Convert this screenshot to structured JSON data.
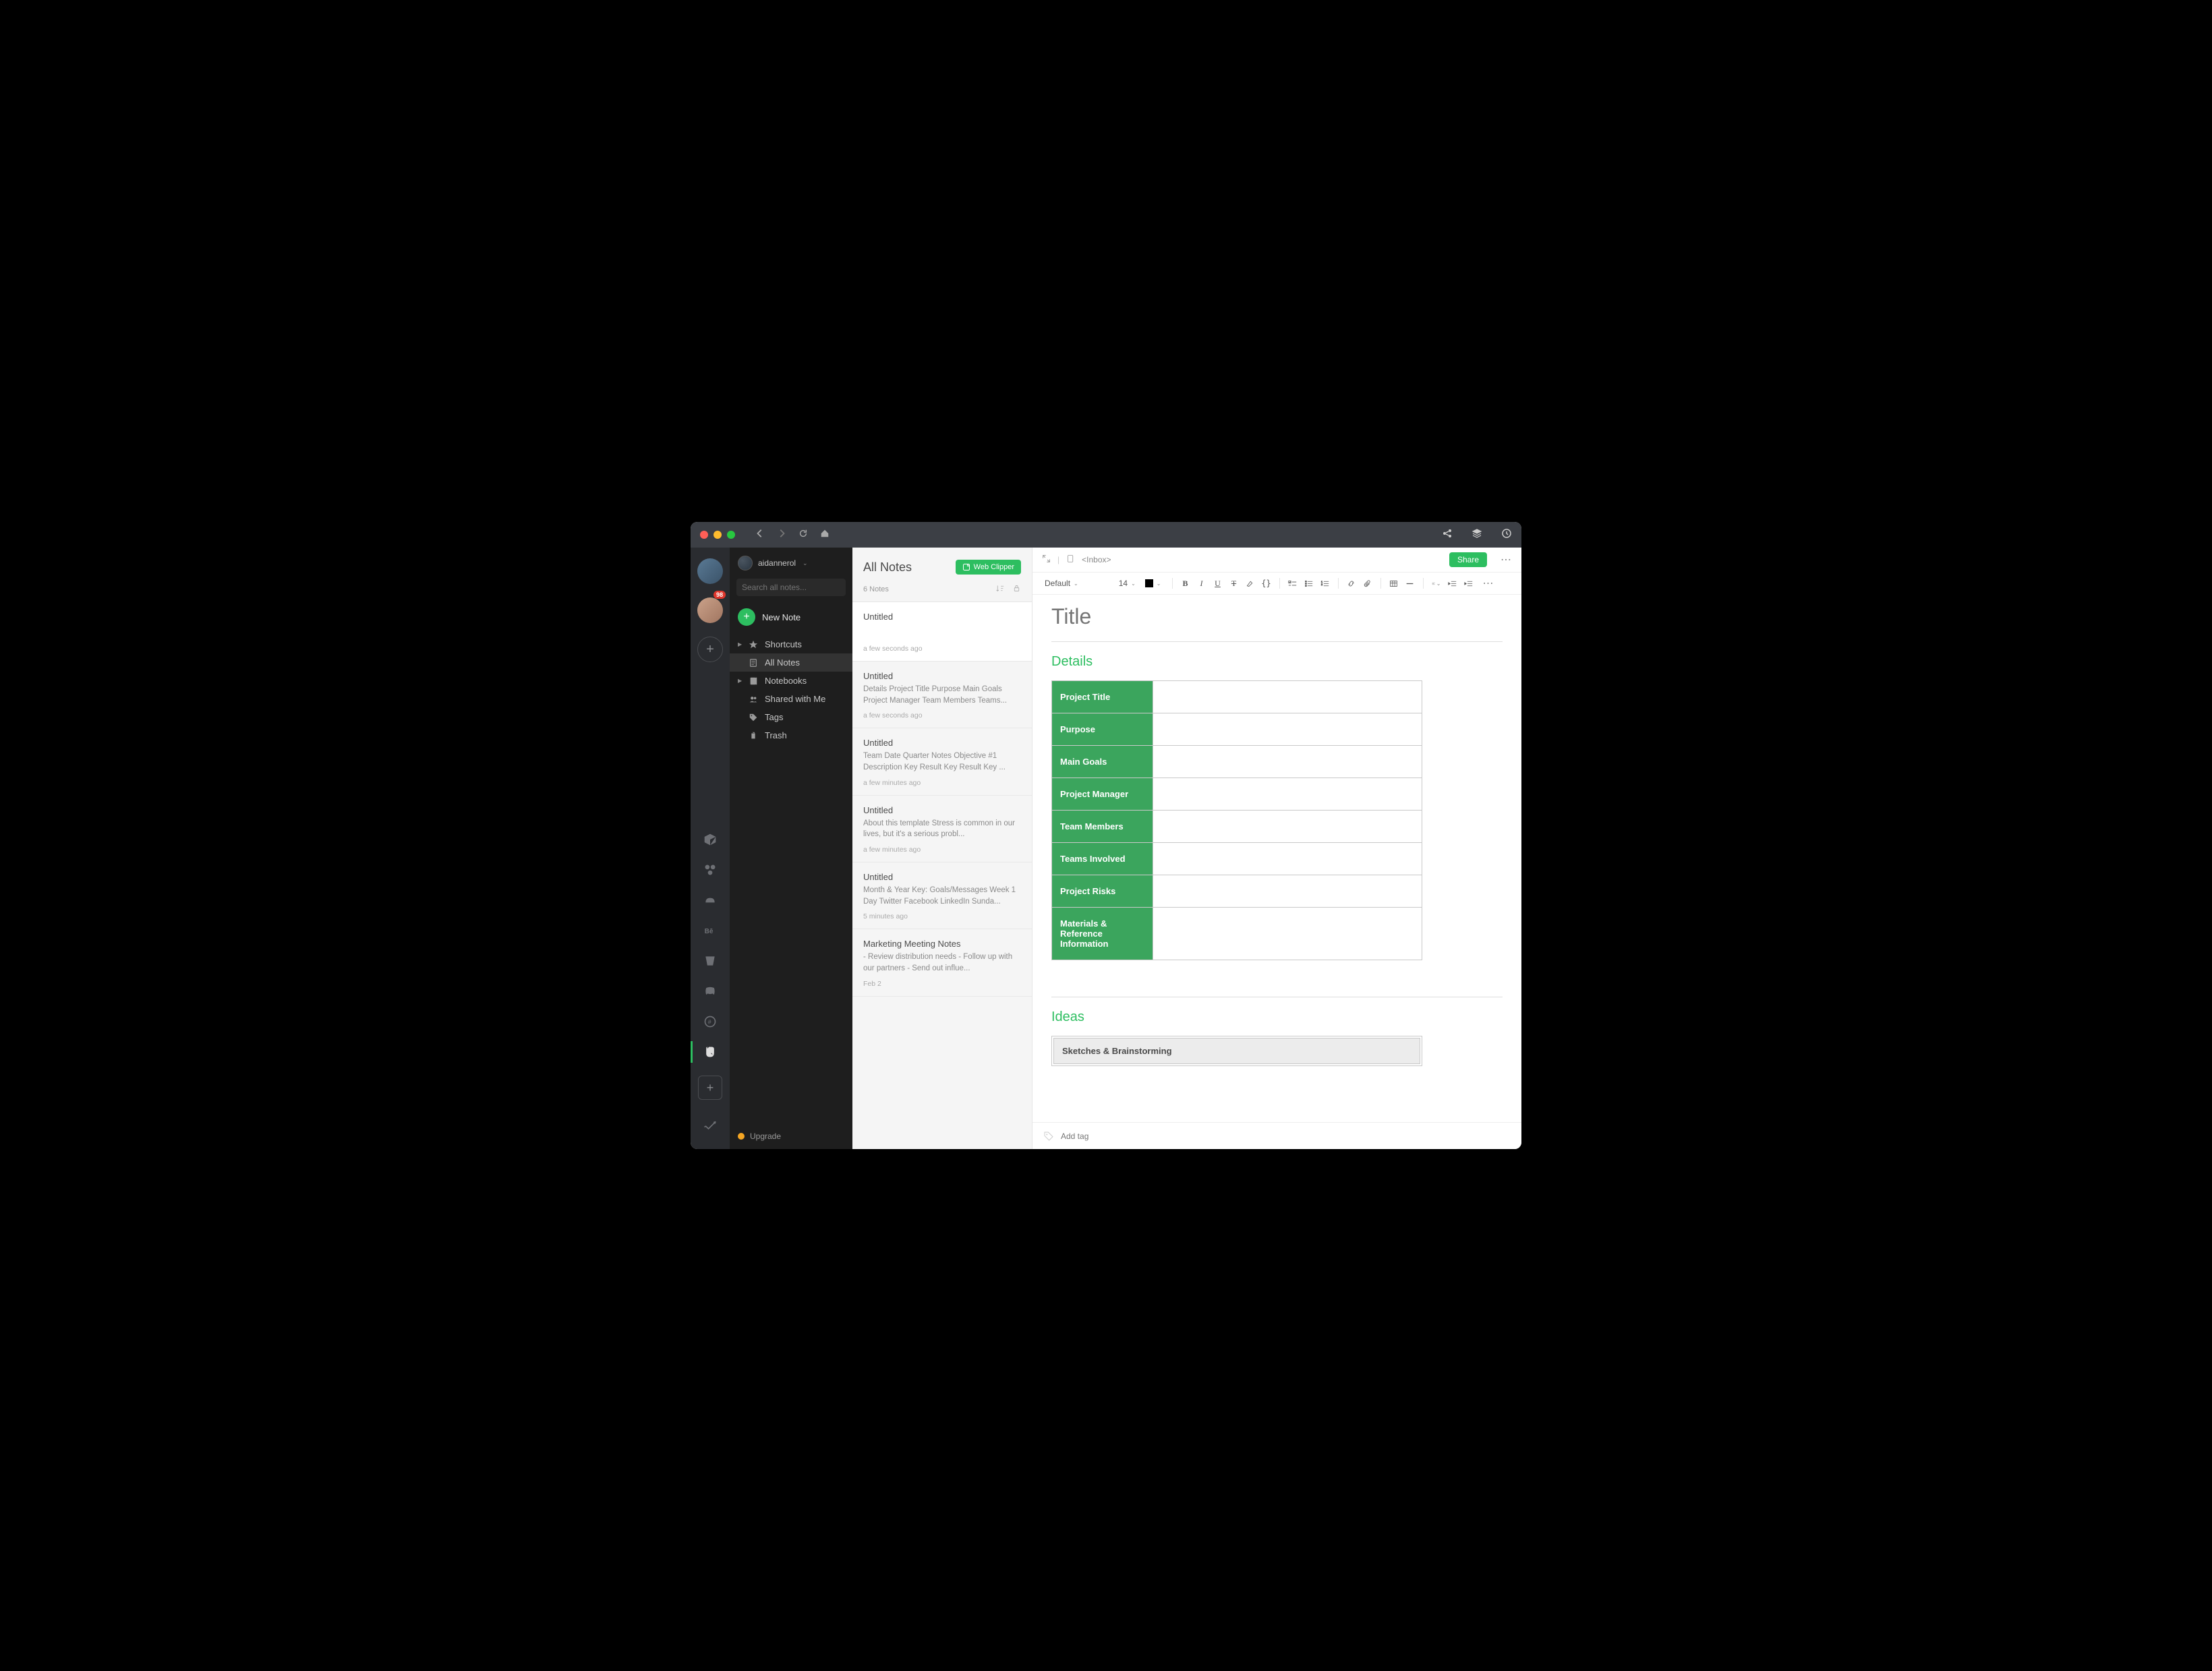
{
  "titlebar": {
    "badge_count": "98"
  },
  "account": {
    "name": "aidannerol"
  },
  "search": {
    "placeholder": "Search all notes..."
  },
  "newnote_label": "New Note",
  "nav": {
    "shortcuts": "Shortcuts",
    "allnotes": "All Notes",
    "notebooks": "Notebooks",
    "shared": "Shared with Me",
    "tags": "Tags",
    "trash": "Trash"
  },
  "upgrade": "Upgrade",
  "notelist": {
    "heading": "All Notes",
    "web_clipper": "Web Clipper",
    "count": "6 Notes",
    "items": [
      {
        "title": "Untitled",
        "preview": "",
        "time": "a few seconds ago"
      },
      {
        "title": "Untitled",
        "preview": "Details Project Title Purpose Main Goals Project Manager Team Members Teams...",
        "time": "a few seconds ago"
      },
      {
        "title": "Untitled",
        "preview": "Team Date Quarter Notes Objective #1 Description Key Result Key Result Key ...",
        "time": "a few minutes ago"
      },
      {
        "title": "Untitled",
        "preview": "About this template Stress is common in our lives, but it's a serious probl...",
        "time": "a few minutes ago"
      },
      {
        "title": "Untitled",
        "preview": "Month & Year Key: Goals/Messages Week 1 Day Twitter Facebook LinkedIn Sunda...",
        "time": "5 minutes ago"
      },
      {
        "title": "Marketing Meeting Notes",
        "preview": "- Review distribution needs - Follow up with our partners - Send out influe...",
        "time": "Feb 2"
      }
    ]
  },
  "editor": {
    "breadcrumb": "<Inbox>",
    "share": "Share",
    "font": "Default",
    "fontsize": "14",
    "title_placeholder": "Title",
    "sections": {
      "details": "Details",
      "ideas": "Ideas",
      "sketches": "Sketches & Brainstorming"
    },
    "details_rows": [
      "Project Title",
      "Purpose",
      "Main Goals",
      "Project Manager",
      "Team Members",
      "Teams Involved",
      "Project Risks",
      "Materials & Reference Information"
    ],
    "addtag_placeholder": "Add tag"
  }
}
